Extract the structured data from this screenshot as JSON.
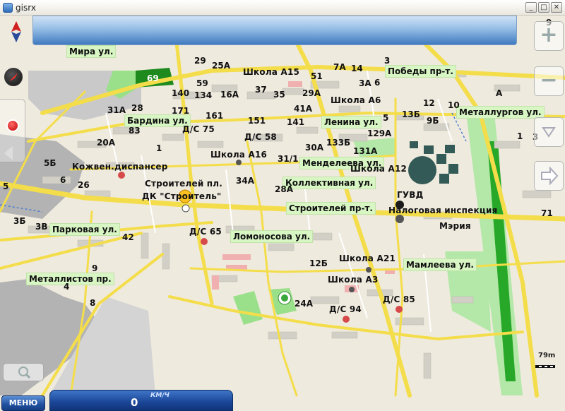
{
  "window": {
    "title": "gisrx"
  },
  "streets": {
    "mira": "Мира ул.",
    "pobedy": "Победы пр-т.",
    "metallurgov": "Металлургов ул.",
    "bardina": "Бардина ул.",
    "lenina": "Ленина ул.",
    "mendeleeva": "Менделеева ул.",
    "kollektivnaya": "Коллективная ул.",
    "stroiteley_pr": "Строителей пр-т.",
    "parkovaya": "Парковая ул.",
    "lomonosova": "Ломоносова ул.",
    "mamleeva": "Мамлеева ул.",
    "metallistov": "Металлистов пр."
  },
  "places": {
    "shkola_a15": "Школа А15",
    "shkola_a6": "Школа А6",
    "shkola_a16": "Школа А16",
    "shkola_a12": "Школа А12",
    "shkola_a21": "Школа А21",
    "shkola_a3": "Школа А3",
    "ds75": "Д/С 75",
    "ds58": "Д/С 58",
    "ds65": "Д/С 65",
    "ds85": "Д/С 85",
    "ds94": "Д/С 94",
    "kozhven": "Кожвен.диспансер",
    "stroiteley_pl": "Строителей пл.",
    "dk": "ДК \"Строитель\"",
    "guvd": "ГУВД",
    "nalog": "Налоговая инспекция",
    "meriya": "Мэрия"
  },
  "numbers": {
    "n69": "69",
    "n29": "29",
    "n25a": "25А",
    "n59": "59",
    "n140": "140",
    "n134": "134",
    "n16a": "16А",
    "n37": "37",
    "n35": "35",
    "n29a": "29А",
    "n51": "51",
    "n7a": "7А",
    "n14": "14",
    "n3": "3",
    "n3a": "3А",
    "n6": "6",
    "n12": "12",
    "n10": "10",
    "na": "А",
    "n31a": "31А",
    "n28": "28",
    "n171": "171",
    "n161": "161",
    "n41a": "41А",
    "n151": "151",
    "n141": "141",
    "n13b": "13Б",
    "n9b": "9Б",
    "n5": "5",
    "n129a": "129А",
    "n83": "83",
    "n20a": "20А",
    "n1": "1",
    "n30a": "30А",
    "n133b": "133Б",
    "n131a": "131А",
    "n31_1": "31/1",
    "n5b": "5Б",
    "n26": "26",
    "n6b": "6",
    "n34a": "34А",
    "n28a": "28А",
    "n5l": "5",
    "n3b": "3Б",
    "n3v": "3В",
    "n42": "42",
    "n71": "71",
    "n12b": "12Б",
    "n9": "9",
    "n4": "4",
    "n8": "8",
    "n24a": "24А",
    "n1r": "1",
    "n3r": "3",
    "n9r": "9"
  },
  "speed": {
    "value": "0",
    "unit": "КМ/Ч"
  },
  "scale": {
    "label": "79m"
  },
  "controls": {
    "menu_label": "МЕНЮ",
    "zoom_in": "+",
    "zoom_out": "−"
  }
}
